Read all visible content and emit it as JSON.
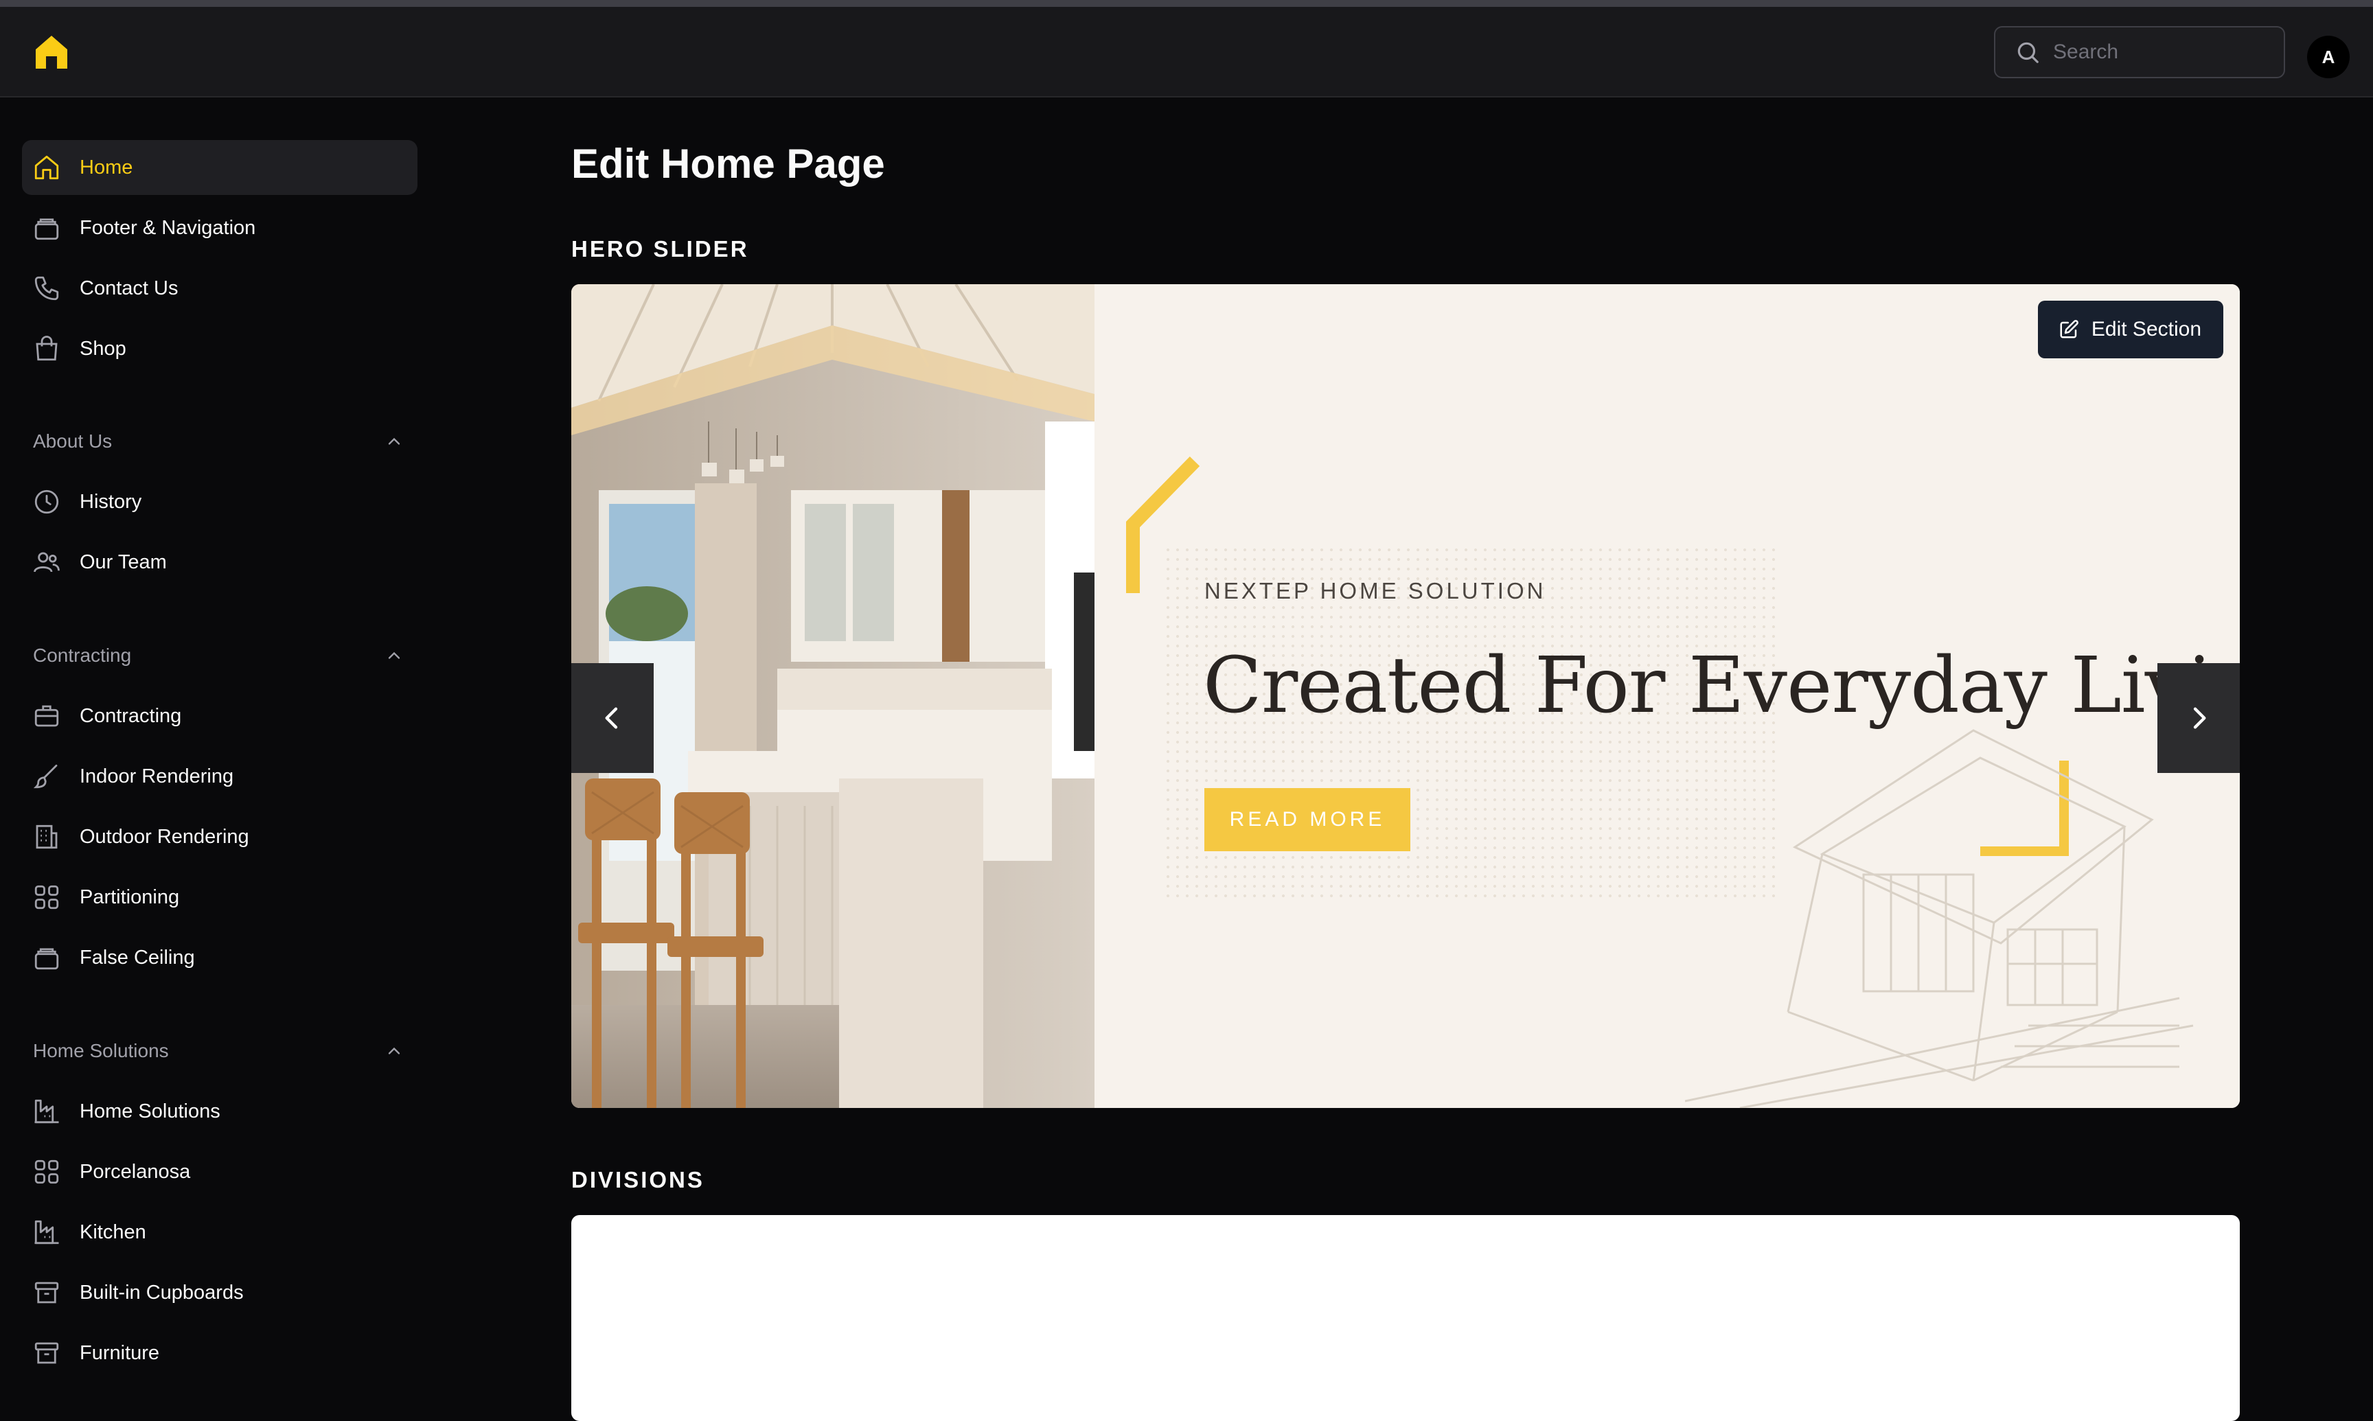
{
  "header": {
    "search_placeholder": "Search",
    "avatar_initial": "A"
  },
  "sidebar": {
    "top_items": [
      {
        "label": "Home",
        "icon": "home-icon",
        "active": true
      },
      {
        "label": "Footer & Navigation",
        "icon": "layers-icon"
      },
      {
        "label": "Contact Us",
        "icon": "phone-icon"
      },
      {
        "label": "Shop",
        "icon": "shopping-bag-icon"
      }
    ],
    "groups": [
      {
        "label": "About Us",
        "items": [
          {
            "label": "History",
            "icon": "clock-icon"
          },
          {
            "label": "Our Team",
            "icon": "users-icon"
          }
        ]
      },
      {
        "label": "Contracting",
        "items": [
          {
            "label": "Contracting",
            "icon": "briefcase-icon"
          },
          {
            "label": "Indoor Rendering",
            "icon": "paintbrush-icon"
          },
          {
            "label": "Outdoor Rendering",
            "icon": "building-icon"
          },
          {
            "label": "Partitioning",
            "icon": "grid-icon"
          },
          {
            "label": "False Ceiling",
            "icon": "layers-icon"
          }
        ]
      },
      {
        "label": "Home Solutions",
        "items": [
          {
            "label": "Home Solutions",
            "icon": "factory-icon"
          },
          {
            "label": "Porcelanosa",
            "icon": "grid-icon"
          },
          {
            "label": "Kitchen",
            "icon": "factory-icon"
          },
          {
            "label": "Built-in Cupboards",
            "icon": "archive-icon"
          },
          {
            "label": "Furniture",
            "icon": "archive-icon"
          }
        ]
      }
    ]
  },
  "main": {
    "page_title": "Edit Home Page",
    "hero_section_title": "HERO SLIDER",
    "divisions_section_title": "DIVISIONS",
    "hero": {
      "kicker": "NEXTEP HOME SOLUTION",
      "headline": "Created For Everyday Living",
      "button_label": "READ MORE",
      "edit_label": "Edit Section",
      "accent_color": "#f5c842"
    }
  },
  "colors": {
    "accent": "#facc15",
    "background": "#09090b",
    "header": "#18181b"
  }
}
